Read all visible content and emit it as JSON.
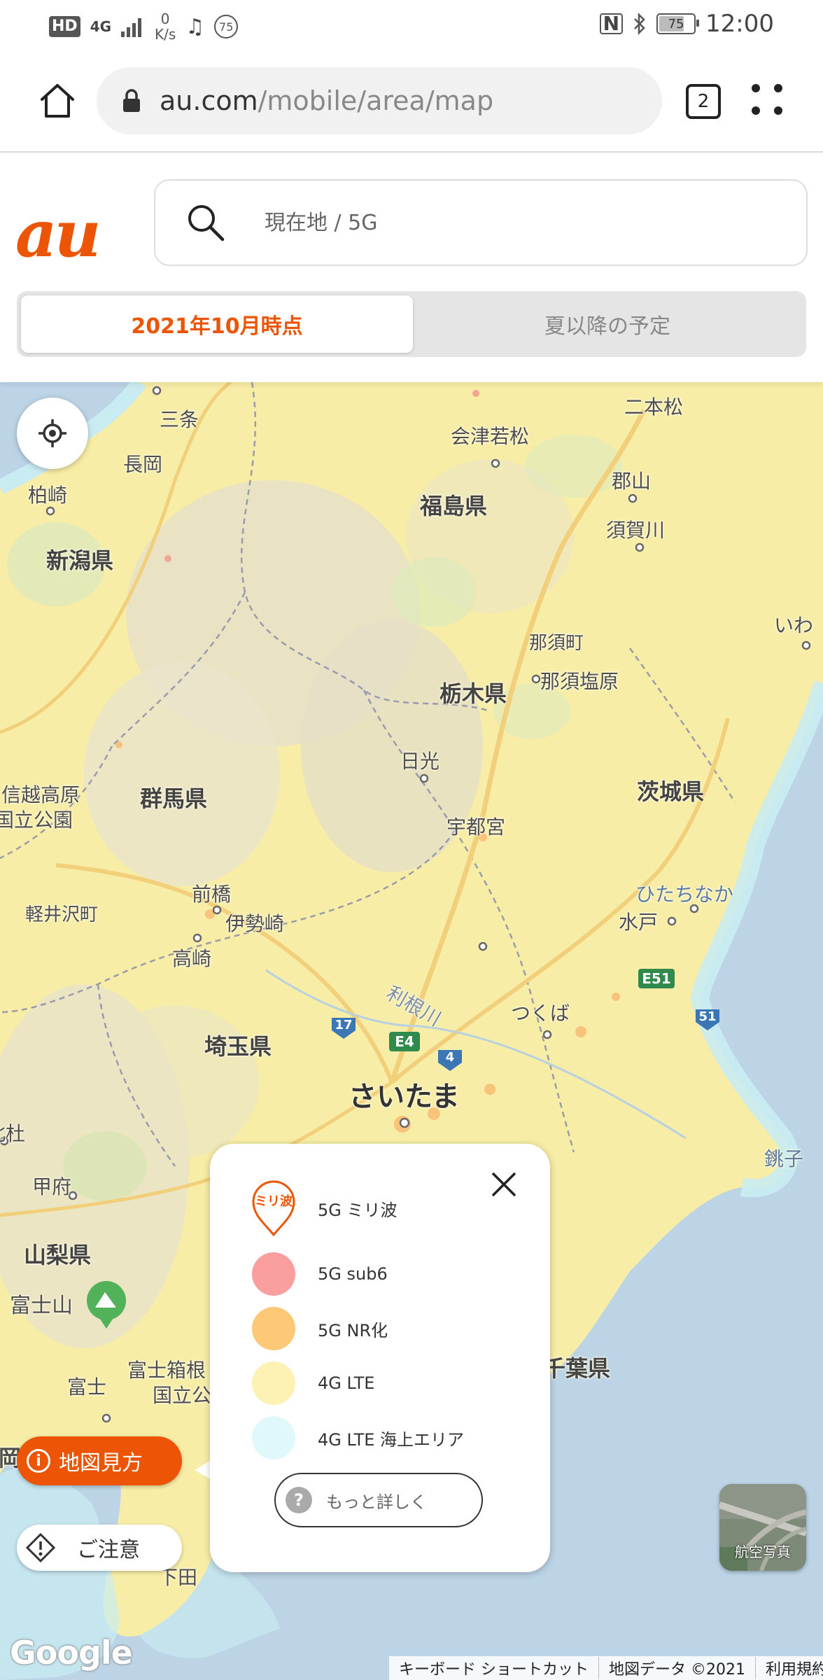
{
  "status_bar": {
    "hd": "HD",
    "network": "4G",
    "speed_value": "0",
    "speed_unit": "K/s",
    "notification_count": "75",
    "battery": "75",
    "battery_level": 0.75,
    "time": "12:00"
  },
  "browser": {
    "url_host": "au.com",
    "url_path": "/mobile/area/map",
    "tab_count": "2"
  },
  "header": {
    "logo": "au",
    "search_placeholder": "現在地 / 5G",
    "tabs": [
      {
        "label": "2021年10月時点",
        "active": true
      },
      {
        "label": "夏以降の予定",
        "active": false
      }
    ]
  },
  "map": {
    "labels": {
      "sanjo": "三条",
      "nihonmatsu": "二本松",
      "aizuwakamatsu": "会津若松",
      "nagaoka": "長岡",
      "koriyama": "郡山",
      "kashiwazaki": "柏崎",
      "fukushima_pref": "福島県",
      "sukagawa": "須賀川",
      "niigata_pref": "新潟県",
      "iwaki": "いわ",
      "nasu": "那須町",
      "nasushiobara": "那須塩原",
      "tochigi_pref": "栃木県",
      "nikko": "日光",
      "joshinetsu_1": "信越高原",
      "joshinetsu_2": "国立公園",
      "gunma_pref": "群馬県",
      "ibaraki_pref": "茨城県",
      "utsunomiya": "宇都宮",
      "maebashi": "前橋",
      "hitachinaka": "ひたちなか",
      "karuizawa": "軽井沢町",
      "isesaki": "伊勢崎",
      "mito": "水戸",
      "takasaki": "高崎",
      "tonegawa": "利根川",
      "tsukuba": "つくば",
      "saitama_pref": "埼玉県",
      "saitama": "さいたま",
      "kitamori": "北杜",
      "choshi": "銚子",
      "kofu": "甲府",
      "yamanashi_pref": "山梨県",
      "fujisan": "富士山",
      "fuji": "富士",
      "fujihakone_1": "富士箱根",
      "fujihakone_2": "国立公",
      "chiba_pref": "千葉県",
      "shimoda": "下田",
      "shizuoka_partial": "岡",
      "route_e51": "E51",
      "route_51": "51",
      "route_17": "17",
      "route_e4": "E4",
      "route_4": "4"
    },
    "howto_label": "地図見方",
    "caution_label": "ご注意",
    "aerial_label": "航空写真",
    "google_logo": "Google",
    "attribution": [
      "キーボード ショートカット",
      "地図データ ©2021",
      "利用規約"
    ]
  },
  "legend": {
    "badge_text": "ミリ波",
    "items": [
      {
        "label": "5G ミリ波",
        "color": "#eb5505"
      },
      {
        "label": "5G sub6",
        "color": "#fb9ea0"
      },
      {
        "label": "5G NR化",
        "color": "#fdc976"
      },
      {
        "label": "4G LTE",
        "color": "#fdf2b4"
      },
      {
        "label": "4G LTE 海上エリア",
        "color": "#e1f8fb"
      }
    ],
    "more_label": "もっと詳しく"
  },
  "colors": {
    "brand": "#eb5505",
    "land": "#f8eda6",
    "sea": "#bcd4e6",
    "coast": "#c9ecf2"
  }
}
